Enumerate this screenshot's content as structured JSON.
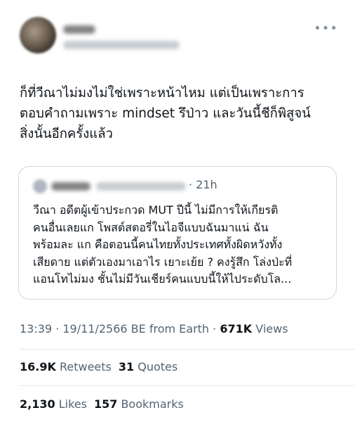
{
  "tweet": {
    "more_icon": "more-horizontal-icon",
    "text": "ก็ที่วีณาไม่มงไม่ใช่เพราะหน้าไหม แต่เป็นเพราะการ\nตอบคำถามเพราะ mindset รึป่าว และวันนี้ชีก็พิสูจน์\nสิ่งนั้นอีกครั้งแล้ว"
  },
  "quote": {
    "time": "· 21h",
    "text": "วีณา อดีตผู้เข้าประกวด MUT ปีนี้ ไม่มีการให้เกียรติ\nคนอื่นเลยแก โพสต์สตอรี่ในไอจีแบบฉันมาแน่ ฉัน\nพร้อมละ แก คือตอนนี้คนไทยทั้งประเทศทั้งผิดหวังทั้ง\nเสียดาย แต่ตัวเองมาเอาไร เยาะเย้ย ? คงรู้สึก โล่งป่ะที่\nแอนโทไม่มง ชั้นไม่มีวันเชียร์คนแบบนี้ให้ไประดับโล..."
  },
  "meta": {
    "timestamp": "13:39 · 19/11/2566 BE from Earth ·",
    "views_count": "671K",
    "views_label": "Views"
  },
  "stats": {
    "retweets_count": "16.9K",
    "retweets_label": "Retweets",
    "quotes_count": "31",
    "quotes_label": "Quotes",
    "likes_count": "2,130",
    "likes_label": "Likes",
    "bookmarks_count": "157",
    "bookmarks_label": "Bookmarks"
  }
}
